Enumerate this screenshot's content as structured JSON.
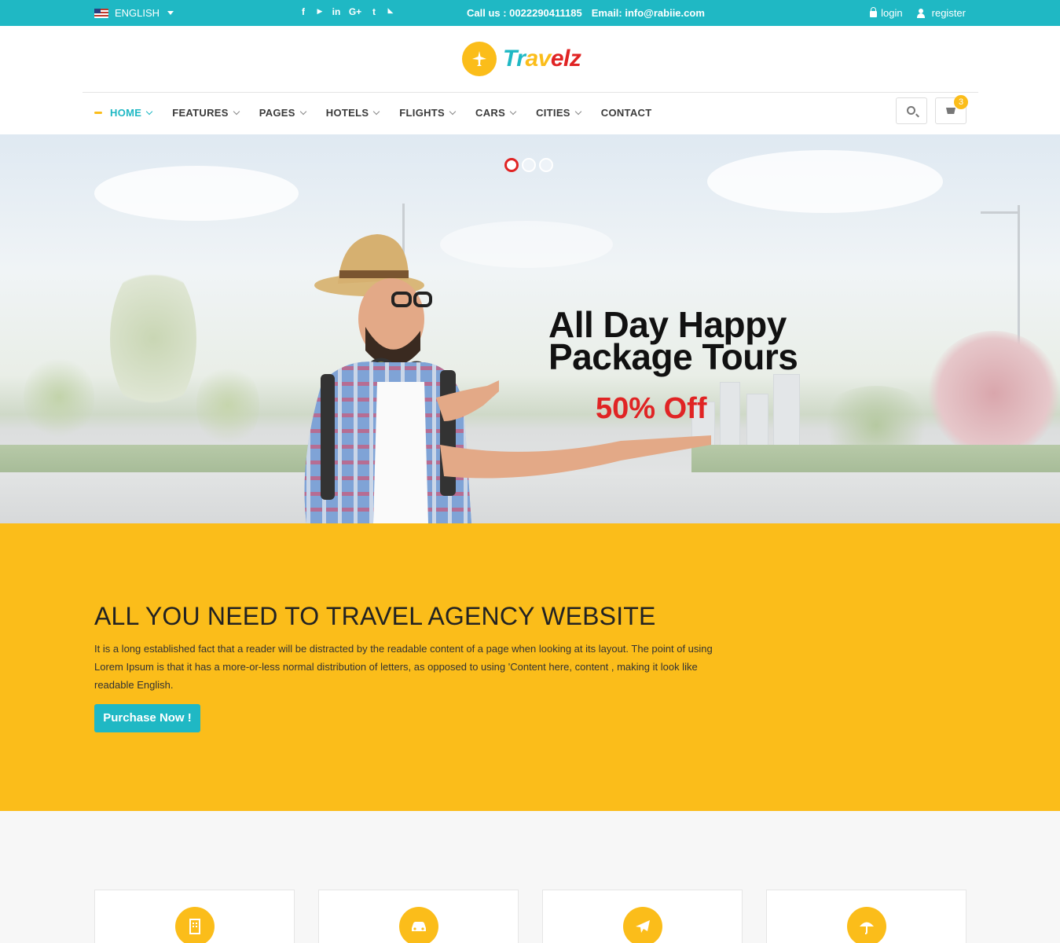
{
  "topbar": {
    "language": "ENGLISH",
    "social_icons": [
      "facebook-icon",
      "youtube-icon",
      "linkedin-icon",
      "google-plus-icon",
      "twitter-icon",
      "rss-icon"
    ],
    "social_glyphs": [
      "f",
      "▶",
      "in",
      "G+",
      "t",
      "◣"
    ],
    "phone": "Call us : 0022290411185",
    "email": "Email: info@rabiie.com",
    "login": "login",
    "register": "register"
  },
  "logo": {
    "part1": "Tr",
    "part2": "av",
    "part3": "elz"
  },
  "nav": {
    "items": [
      {
        "label": "HOME",
        "active": true
      },
      {
        "label": "FEATURES"
      },
      {
        "label": "PAGES"
      },
      {
        "label": "HOTELS"
      },
      {
        "label": "FLIGHTS"
      },
      {
        "label": "CARS"
      },
      {
        "label": "CITIES"
      },
      {
        "label": "CONTACT"
      }
    ],
    "cart_count": "3"
  },
  "hero": {
    "title_line1": "All Day Happy",
    "title_line2": "Package Tours",
    "offer": "50% Off",
    "slides": 3,
    "active_slide": 1
  },
  "promo": {
    "heading": "ALL YOU NEED TO TRAVEL AGENCY WEBSITE",
    "text": "It is a long established fact that a reader will be distracted by the readable content of a page when looking at its layout. The point of using Lorem Ipsum is that it has a more-or-less normal distribution of letters, as opposed to using 'Content here, content , making it look like readable English.",
    "button": "Purchase Now !"
  },
  "features": {
    "icons": [
      "building-icon",
      "car-icon",
      "airplane-icon",
      "umbrella-icon"
    ]
  },
  "colors": {
    "accent": "#1fb8c4",
    "yellow": "#fbbd1a",
    "red": "#e02424"
  }
}
